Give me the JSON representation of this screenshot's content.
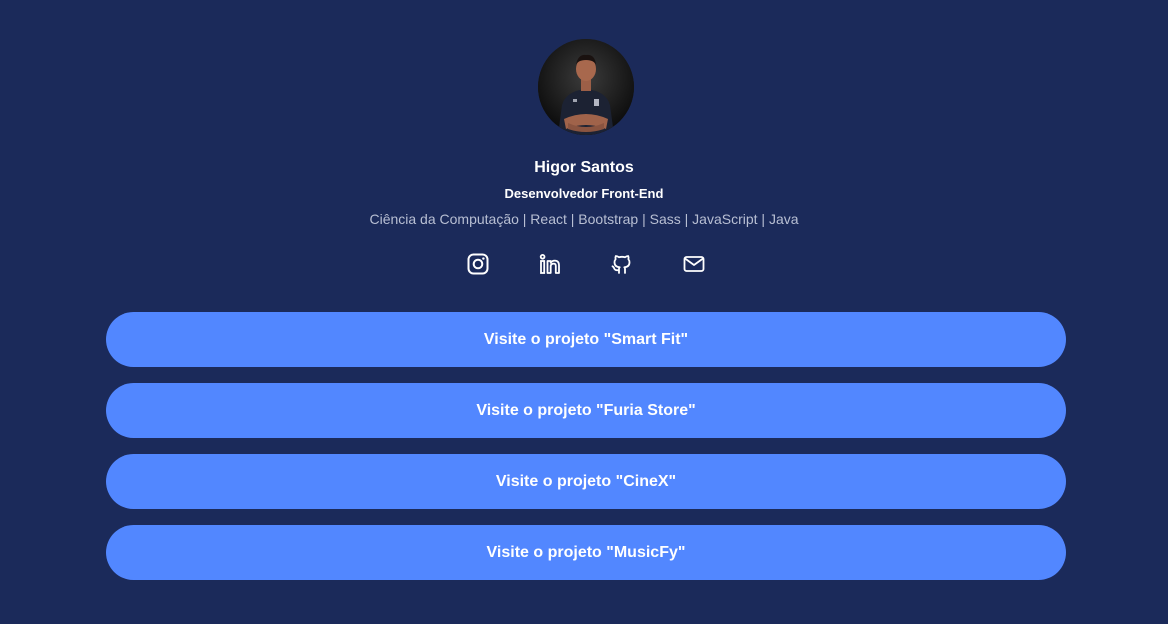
{
  "profile": {
    "name": "Higor Santos",
    "role": "Desenvolvedor Front-End",
    "skills": "Ciência da Computação | React | Bootstrap | Sass | JavaScript | Java"
  },
  "socials": [
    {
      "icon": "instagram-icon"
    },
    {
      "icon": "linkedin-icon"
    },
    {
      "icon": "github-icon"
    },
    {
      "icon": "mail-icon"
    }
  ],
  "projects": [
    {
      "label": "Visite o projeto \"Smart Fit\""
    },
    {
      "label": "Visite o projeto \"Furia Store\""
    },
    {
      "label": "Visite o projeto \"CineX\""
    },
    {
      "label": "Visite o projeto \"MusicFy\""
    }
  ],
  "colors": {
    "background": "#1b2a5a",
    "button": "#5287ff",
    "text": "#ffffff",
    "muted_text": "#b8bfd3"
  }
}
